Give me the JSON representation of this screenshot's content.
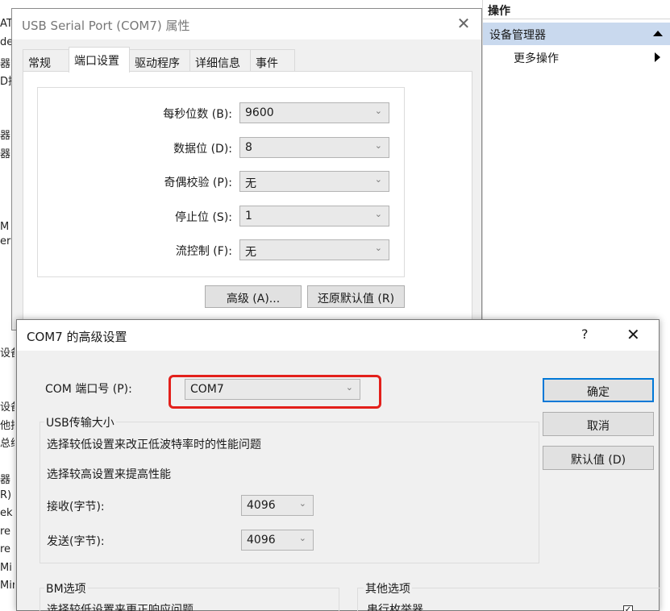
{
  "background": {
    "left_fragments": [
      "AT",
      "de",
      "器管",
      "D提",
      "器",
      "器",
      "M 利",
      "eri",
      "设备",
      "设备",
      "他指",
      "总线",
      "器",
      "R) V",
      "ek I",
      "re",
      "re",
      "Mi",
      "Mir"
    ]
  },
  "actions_pane": {
    "header": "操作",
    "selected_item": "设备管理器",
    "more_actions": "更多操作"
  },
  "properties_window": {
    "title": "USB Serial Port (COM7) 属性",
    "tabs": [
      "常规",
      "端口设置",
      "驱动程序",
      "详细信息",
      "事件"
    ],
    "active_tab": "端口设置",
    "fields": [
      {
        "label": "每秒位数 (B):",
        "value": "9600"
      },
      {
        "label": "数据位 (D):",
        "value": "8"
      },
      {
        "label": "奇偶校验 (P):",
        "value": "无"
      },
      {
        "label": "停止位 (S):",
        "value": "1"
      },
      {
        "label": "流控制 (F):",
        "value": "无"
      }
    ],
    "advanced_button": "高级 (A)...",
    "restore_button": "还原默认值 (R)"
  },
  "advanced_dialog": {
    "title": "COM7 的高级设置",
    "help": "?",
    "com_port_label": "COM 端口号 (P):",
    "com_port_value": "COM7",
    "usb_group_title": "USB传输大小",
    "usb_desc_low": "选择较低设置来改正低波特率时的性能问题",
    "usb_desc_high": "选择较高设置来提高性能",
    "receive_label": "接收(字节):",
    "receive_value": "4096",
    "send_label": "发送(字节):",
    "send_value": "4096",
    "bm_group_title": "BM选项",
    "bm_desc": "选择较低设置来更正响应问题",
    "other_group_title": "其他选项",
    "serial_enum_label": "串行枚举器",
    "ok_button": "确定",
    "cancel_button": "取消",
    "defaults_button": "默认值 (D)"
  },
  "colors": {
    "highlight_box": "#e3201b",
    "selected_row": "#c9d9ee",
    "default_button_border": "#0078d7"
  }
}
